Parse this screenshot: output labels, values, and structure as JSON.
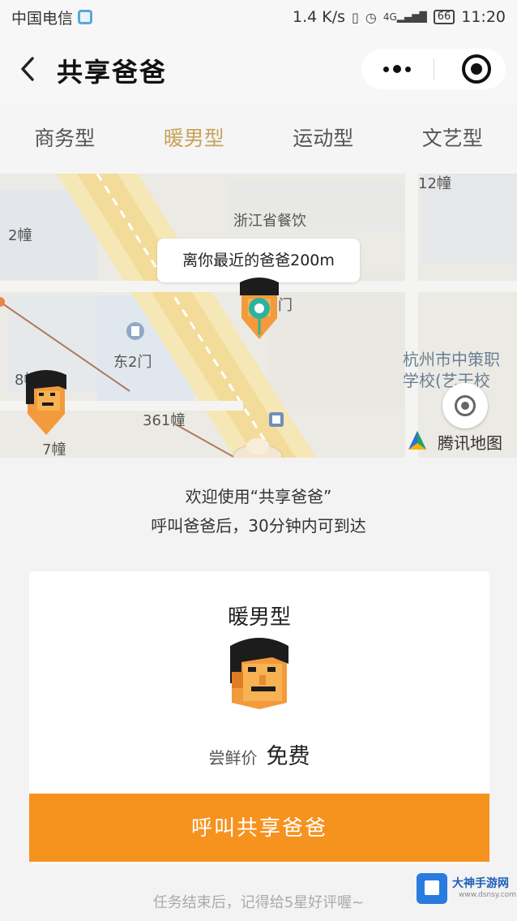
{
  "status_bar": {
    "carrier": "中国电信",
    "speed": "1.4 K/s",
    "signal_badge": "4G",
    "battery": "66",
    "time": "11:20"
  },
  "nav": {
    "title": "共享爸爸"
  },
  "tabs": [
    {
      "label": "商务型",
      "active": false
    },
    {
      "label": "暖男型",
      "active": true
    },
    {
      "label": "运动型",
      "active": false
    },
    {
      "label": "文艺型",
      "active": false
    }
  ],
  "map": {
    "labels": {
      "building_12": "12幢",
      "building_2": "2幢",
      "poi_restaurant": "浙江省餐饮",
      "east_gate_2": "东2门",
      "building_8": "8幢",
      "building_361": "361幢",
      "building_7": "7幢",
      "gate_suffix": "门",
      "school_line1": "杭州市中策职",
      "school_line2": "学校(艺干校"
    },
    "nearest_bubble": "离你最近的爸爸200m",
    "provider": "腾讯地图"
  },
  "welcome": {
    "line1": "欢迎使用“共享爸爸”",
    "line2": "呼叫爸爸后，30分钟内可到达"
  },
  "card": {
    "type_name": "暖男型",
    "price_label": "尝鲜价",
    "price_value": "免费",
    "call_button": "呼叫共享爸爸"
  },
  "footer_note": "任务结束后，记得给5星好评喔~",
  "watermark": {
    "title": "大神手游网",
    "url": "www.dsnsy.com"
  },
  "colors": {
    "accent_orange": "#f6921e",
    "active_tab": "#c9a25a",
    "marker_teal": "#2bb3a0"
  }
}
